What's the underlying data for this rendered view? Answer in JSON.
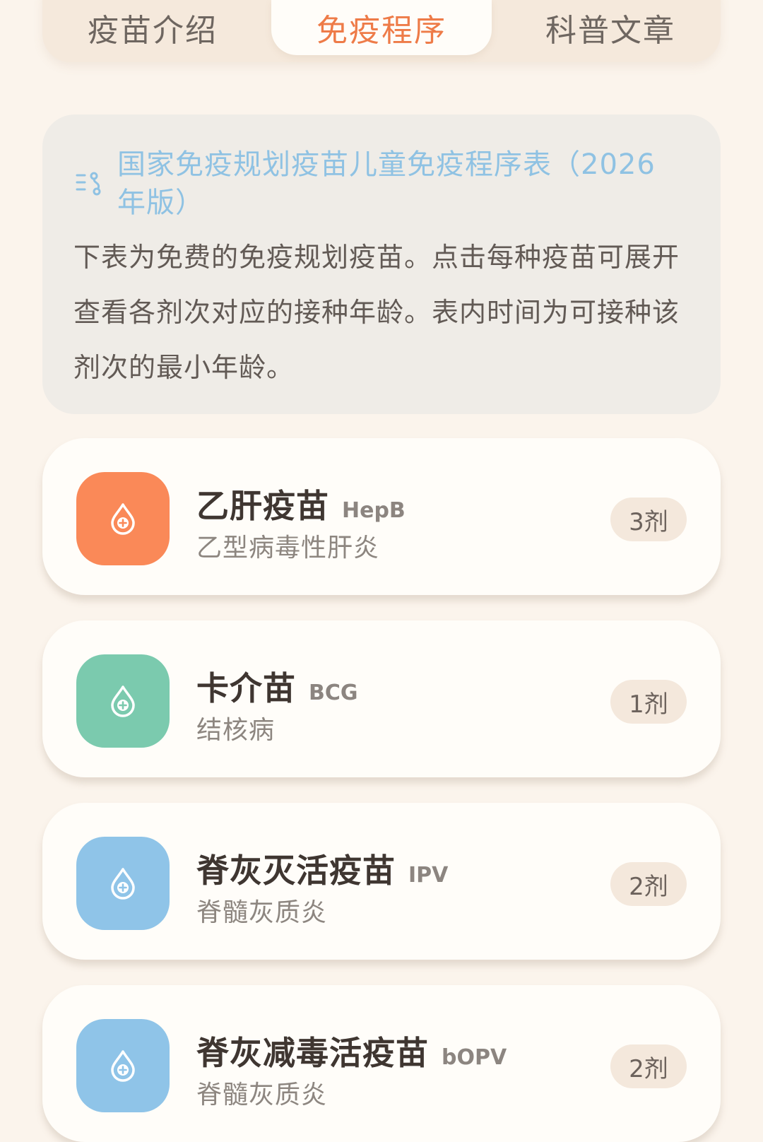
{
  "tabs": [
    {
      "label": "疫苗介绍",
      "active": false
    },
    {
      "label": "免疫程序",
      "active": true
    },
    {
      "label": "科普文章",
      "active": false
    }
  ],
  "info": {
    "icon": "schedule-route-icon",
    "title": "国家免疫规划疫苗儿童免疫程序表（2026年版）",
    "description": "下表为免费的免疫规划疫苗。点击每种疫苗可展开查看各剂次对应的接种年龄。表内时间为可接种该剂次的最小年龄。"
  },
  "vaccines": [
    {
      "name": "乙肝疫苗",
      "abbr": "HepB",
      "disease": "乙型病毒性肝炎",
      "dose": "3剂",
      "icon": "vaccine-drop-icon",
      "color": "#fa8958"
    },
    {
      "name": "卡介苗",
      "abbr": "BCG",
      "disease": "结核病",
      "dose": "1剂",
      "icon": "vaccine-drop-icon",
      "color": "#7bcaae"
    },
    {
      "name": "脊灰灭活疫苗",
      "abbr": "IPV",
      "disease": "脊髓灰质炎",
      "dose": "2剂",
      "icon": "vaccine-drop-icon",
      "color": "#8fc4e8"
    },
    {
      "name": "脊灰减毒活疫苗",
      "abbr": "bOPV",
      "disease": "脊髓灰质炎",
      "dose": "2剂",
      "icon": "vaccine-drop-icon",
      "color": "#8fc4e8"
    }
  ]
}
